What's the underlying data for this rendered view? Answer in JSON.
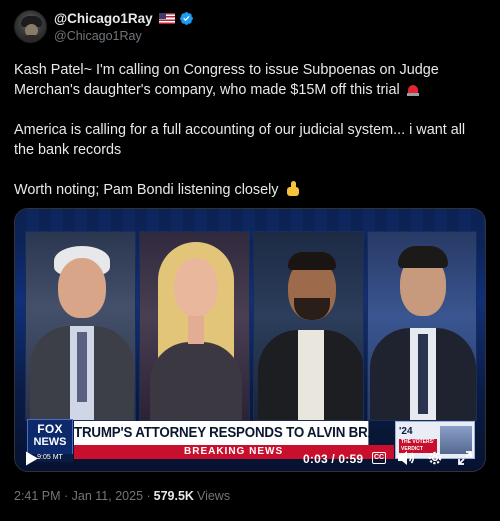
{
  "author": {
    "display_name": "@Chicago1Ray",
    "handle": "@Chicago1Ray",
    "flag_icon": "us-flag-icon",
    "verified_icon": "verified-badge-icon",
    "verified_color": "#1d9bf0"
  },
  "tweet": {
    "lines": [
      "Kash Patel~ I'm calling on Congress to issue Subpoenas on Judge",
      "Merchan's daughter's company, who made $15M off this trial",
      "America is calling for a full accounting of our judicial system... i want all",
      "the bank records",
      "Worth noting; Pam Bondi listening closely"
    ],
    "emoji_1": "police-light-emoji",
    "emoji_2": "thumbs-up-emoji"
  },
  "video": {
    "network_logo_line1": "FOX",
    "network_logo_line2": "NEWS",
    "logo_time": "9:05 MT",
    "headline": "TRUMP'S ATTORNEY RESPONDS TO ALVIN BRAGG",
    "breaking": "BREAKING NEWS",
    "sidebar_year": "'24",
    "sidebar_tag": "THE VOTERS' VERDICT",
    "timecode": "0:03 / 0:59",
    "cc_label": "CC",
    "accent_red": "#c8102e",
    "fox_blue": "#0c2a6b"
  },
  "meta": {
    "timestamp": "2:41 PM · Jan 11, 2025 · ",
    "views_count": "579.5K",
    "views_label": "Views"
  }
}
